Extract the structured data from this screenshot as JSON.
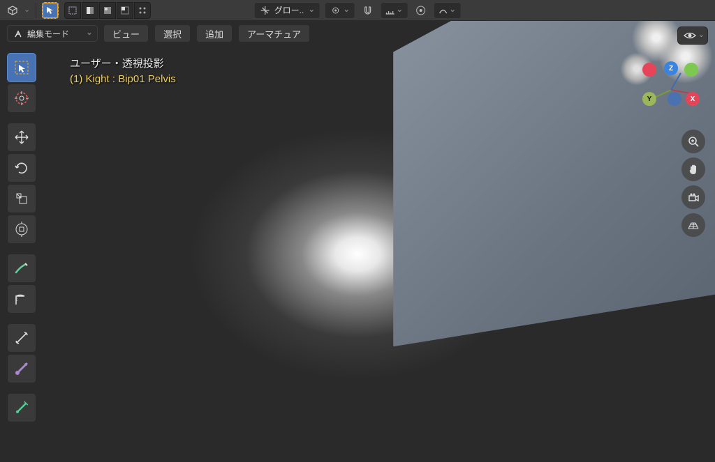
{
  "header": {
    "transform_orientation": "グロー..",
    "mode_label": "編集モード",
    "menus": [
      "ビュー",
      "選択",
      "追加",
      "アーマチュア"
    ]
  },
  "overlay": {
    "projection": "ユーザー・透視投影",
    "object_info": "(1) Kight : Bip01 Pelvis"
  },
  "gizmo": {
    "axes": {
      "x": "X",
      "y": "Y",
      "z": "Z"
    },
    "colors": {
      "x": "#e64458",
      "y": "#7cc850",
      "z": "#3b83e0",
      "neg": "#6a6a6a"
    }
  },
  "icons": {
    "editor_type": "editor-type-icon",
    "cursor": "cursor-icon",
    "select_box": "select-box-icon",
    "transform_pivot": "pivot-icon",
    "snap": "snap-icon",
    "proportional": "proportional-icon",
    "mesh_auto": "mesh-auto-icon",
    "curve": "curve-icon",
    "visibility": "eye-icon"
  }
}
